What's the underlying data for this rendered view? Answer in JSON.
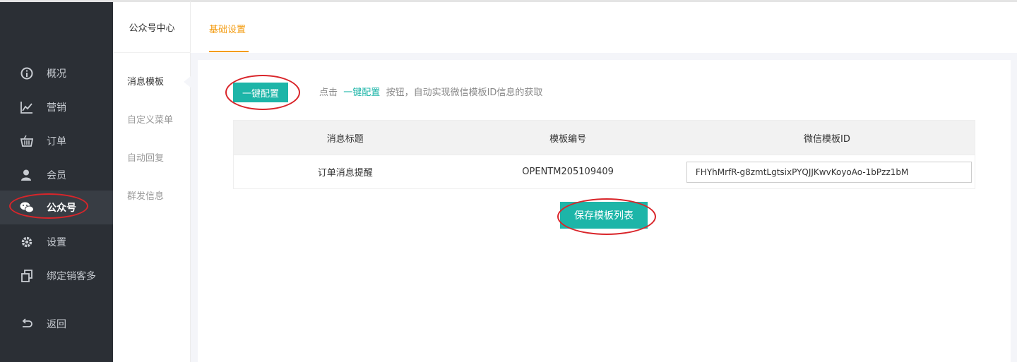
{
  "sidebar": {
    "items": [
      {
        "label": "概况",
        "icon": "info-circle-icon"
      },
      {
        "label": "营销",
        "icon": "line-chart-icon"
      },
      {
        "label": "订单",
        "icon": "basket-icon"
      },
      {
        "label": "会员",
        "icon": "user-icon"
      },
      {
        "label": "公众号",
        "icon": "wechat-icon",
        "active": true
      },
      {
        "label": "设置",
        "icon": "gear-icon"
      },
      {
        "label": "绑定销客多",
        "icon": "link-copy-icon"
      },
      {
        "label": "返回",
        "icon": "return-icon"
      }
    ]
  },
  "subnav": {
    "title": "公众号中心",
    "items": [
      {
        "label": "消息模板",
        "active": true
      },
      {
        "label": "自定义菜单"
      },
      {
        "label": "自动回复"
      },
      {
        "label": "群发信息"
      }
    ]
  },
  "topbar": {
    "tab_label": "基础设置"
  },
  "main": {
    "config_button": "一键配置",
    "hint_prefix": "点击",
    "hint_link": "一键配置",
    "hint_suffix": "按钮，自动实现微信模板ID信息的获取",
    "table": {
      "headers": [
        "消息标题",
        "模板编号",
        "微信模板ID"
      ],
      "rows": [
        {
          "title": "订单消息提醒",
          "code": "OPENTM205109409",
          "wechat_id": "FHYhMrfR-g8zmtLgtsixPYQJJKwvKoyoAo-1bPzz1bM"
        }
      ]
    },
    "save_button": "保存模板列表"
  },
  "colors": {
    "accent": "#1db5a8",
    "tab_active": "#f39c12",
    "sidebar_bg": "#2b2f35",
    "annotation": "#d9252a"
  }
}
